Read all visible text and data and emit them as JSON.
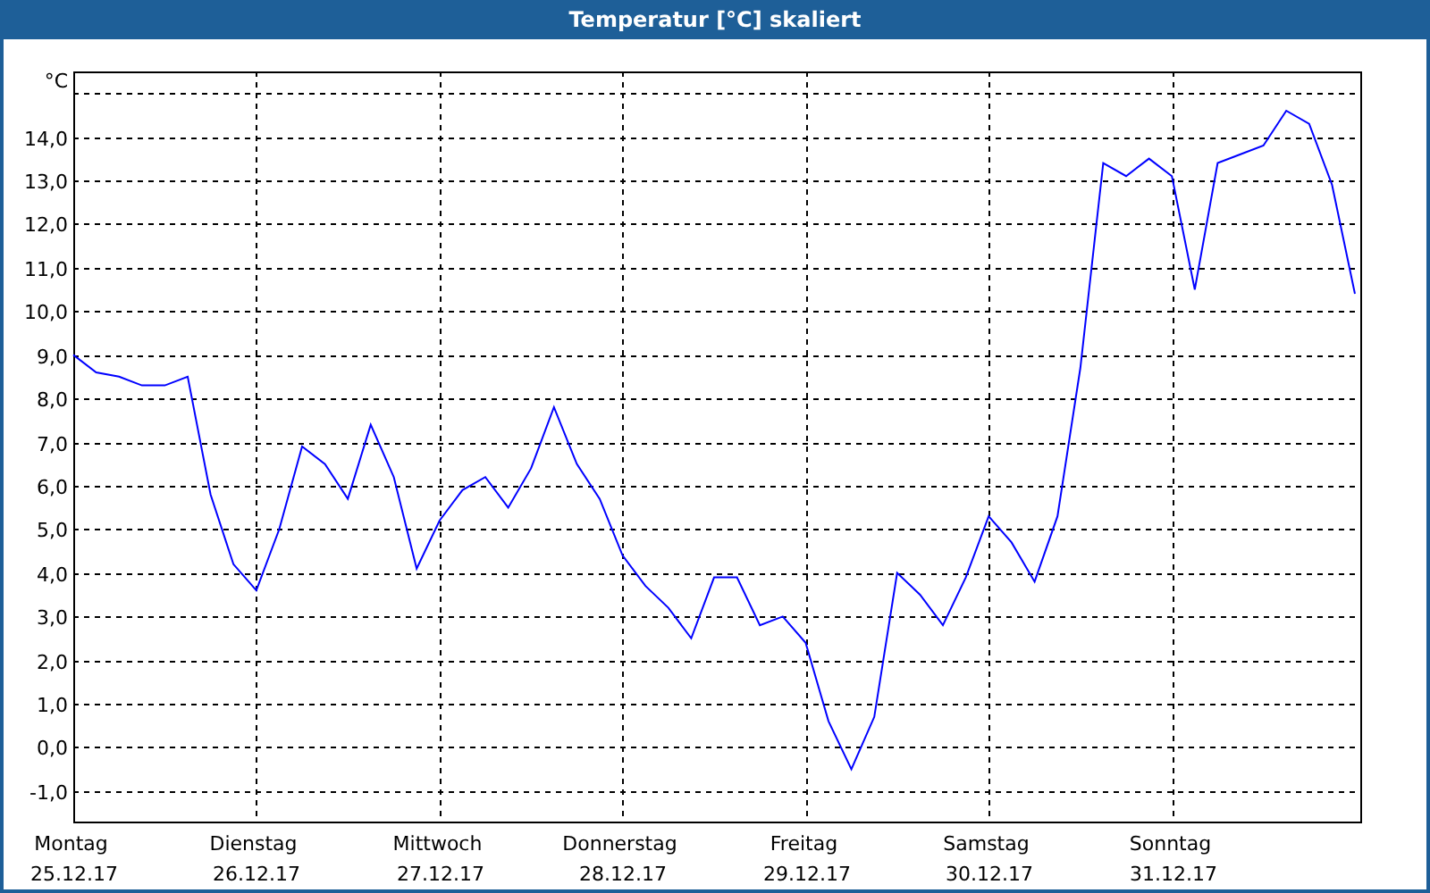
{
  "window": {
    "title": "Temperatur [°C] skaliert"
  },
  "chart": {
    "chart_data": {
      "type": "line",
      "grid": true,
      "ylabel": "°C",
      "ylim": [
        -1.7,
        15.5
      ],
      "yticks": [
        {
          "value": -1,
          "label": "-1,0"
        },
        {
          "value": 0,
          "label": "0,0"
        },
        {
          "value": 1,
          "label": "1,0"
        },
        {
          "value": 2,
          "label": "2,0"
        },
        {
          "value": 3,
          "label": "3,0"
        },
        {
          "value": 4,
          "label": "4,0"
        },
        {
          "value": 5,
          "label": "5,0"
        },
        {
          "value": 6,
          "label": "6,0"
        },
        {
          "value": 7,
          "label": "7,0"
        },
        {
          "value": 8,
          "label": "8,0"
        },
        {
          "value": 9,
          "label": "9,0"
        },
        {
          "value": 10,
          "label": "10,0"
        },
        {
          "value": 11,
          "label": "11,0"
        },
        {
          "value": 12,
          "label": "12,0"
        },
        {
          "value": 13,
          "label": "13,0"
        },
        {
          "value": 14,
          "label": "14,0"
        }
      ],
      "categories": [
        "Montag 25.12.17",
        null,
        null,
        null,
        null,
        null,
        null,
        null,
        "Dienstag 26.12.17",
        null,
        null,
        null,
        null,
        null,
        null,
        null,
        "Mittwoch 27.12.17",
        null,
        null,
        null,
        null,
        null,
        null,
        null,
        "Donnerstag 28.12.17",
        null,
        null,
        null,
        null,
        null,
        null,
        null,
        "Freitag 29.12.17",
        null,
        null,
        null,
        null,
        null,
        null,
        null,
        "Samstag 30.12.17",
        null,
        null,
        null,
        null,
        null,
        null,
        null,
        "Sonntag 31.12.17",
        null,
        null,
        null,
        null,
        null,
        null,
        null,
        null
      ],
      "series": [
        {
          "color": "#0000ff",
          "values": [
            9.0,
            8.6,
            8.5,
            8.3,
            8.3,
            8.5,
            5.8,
            4.2,
            3.6,
            5.0,
            6.9,
            6.5,
            5.7,
            7.4,
            6.2,
            4.1,
            5.2,
            5.9,
            6.2,
            5.5,
            6.4,
            7.8,
            6.5,
            5.7,
            4.4,
            3.7,
            3.2,
            2.5,
            3.9,
            3.9,
            2.8,
            3.0,
            2.4,
            0.6,
            -0.5,
            0.7,
            4.0,
            3.5,
            2.8,
            3.9,
            5.3,
            4.7,
            3.8,
            5.3,
            8.7,
            13.4,
            13.1,
            13.5,
            13.1,
            10.5,
            13.4,
            13.6,
            13.8,
            14.6,
            14.3,
            12.9,
            10.4
          ]
        }
      ]
    }
  }
}
